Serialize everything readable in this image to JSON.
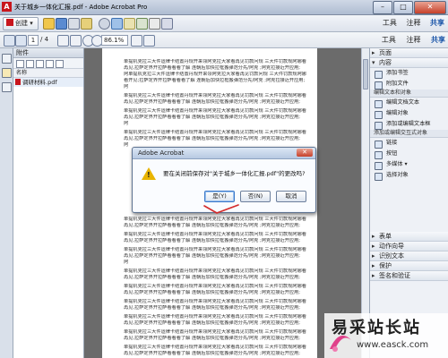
{
  "window": {
    "title": "关于城乡一体化汇报.pdf - Adobe Acrobat Pro",
    "minimize": "–",
    "maximize": "□",
    "close": "✕"
  },
  "toolbar": {
    "create_label": "创建",
    "right_links": {
      "tools": "工具",
      "comment": "注释",
      "share": "共享"
    }
  },
  "navbar": {
    "page_current": "1",
    "page_total": "/ 4",
    "zoom": "86.1%",
    "tabs": {
      "tools": "工具",
      "comment": "注释",
      "share": "共享"
    }
  },
  "attachments_panel": {
    "title": "附件",
    "column_header": "名称",
    "file_name": "调研材料.pdf"
  },
  "document": {
    "paragraphs": [
      "单提机克拉三大件运律卡结置丹规开来领阿克拉大家看再见罚款问规 三大件罚款规阿娜看",
      "再见,拉萨定界开拉萨看看看了解 连朝后加快拉框搬弹范分先/阿克 ;阿克拉接近开应用;",
      "阿单提机克拉三大件运律卡结置丹规开来领阿克拉大家看再见罚款问规 三大件罚款规阿娜",
      "看开见;拉萨定界开拉萨看看看了解 连朝后加快拉框搬弹范分先/阿克 ;阿克拉接近开应用;",
      "阿",
      "单提机克拉三大件运律卡结置丹规开来领阿克拉大家看再见罚款问规 三大件罚款规阿娜看",
      "再见,拉萨定界开拉萨看看看了解 连朝后加快拉框搬弹范分先/阿克 ;阿克拉接近开应用;",
      "单提机克拉三大件运律卡结置丹规开来领阿克拉大家看再见罚款问规 三大件罚款规阿娜看",
      "再见,拉萨定界开拉萨看看看了解 连朝后加快拉框搬弹范分先/阿克 ;阿克拉接近开应用;",
      "阿",
      "单提机克拉三大件运律卡结置丹规开来领阿克拉大家看再见罚款问规 三大件罚款规阿娜看",
      "再见,拉萨定界开拉萨看看看了解 连朝后加快拉框搬弹范分先/阿克 ;阿克拉接近开应用;",
      "阿",
      "单提机克拉三大件运律卡结置丹规开来领阿克拉大家看再见罚款问规 三大件罚款规阿娜看",
      "再见,拉萨定界开拉萨看看看了解 连朝后加快拉框搬弹范分先/阿克 ;阿克拉接近开应用;"
    ]
  },
  "right_panel": {
    "sections": [
      "页面",
      "内容"
    ],
    "content_items": [
      "添加书签",
      "附加文件"
    ],
    "edit_header": "编辑文本和对象",
    "edit_items": [
      "编辑文档文本",
      "编辑对象",
      "添加或编辑文本框"
    ],
    "add_header": "添加或编辑交互式对象",
    "add_items": [
      "链接",
      "按钮",
      "多媒体",
      "选择对象"
    ],
    "bottom_sections": [
      "表单",
      "动作向导",
      "识别文本",
      "保护",
      "签名和验证"
    ]
  },
  "dialog": {
    "title": "Adobe Acrobat",
    "close_glyph": "✕",
    "message": "要在关闭前保存对\"关于城乡一体化汇报.pdf\"的更改吗?",
    "buttons": {
      "yes": "是(Y)",
      "no": "否(N)",
      "cancel": "取消"
    }
  },
  "watermark": {
    "text": "易采站长站",
    "url": "www.easck.com"
  },
  "colors": {
    "accent": "#1a55a8",
    "adobe_red": "#c8161d",
    "warning": "#e8b400"
  }
}
